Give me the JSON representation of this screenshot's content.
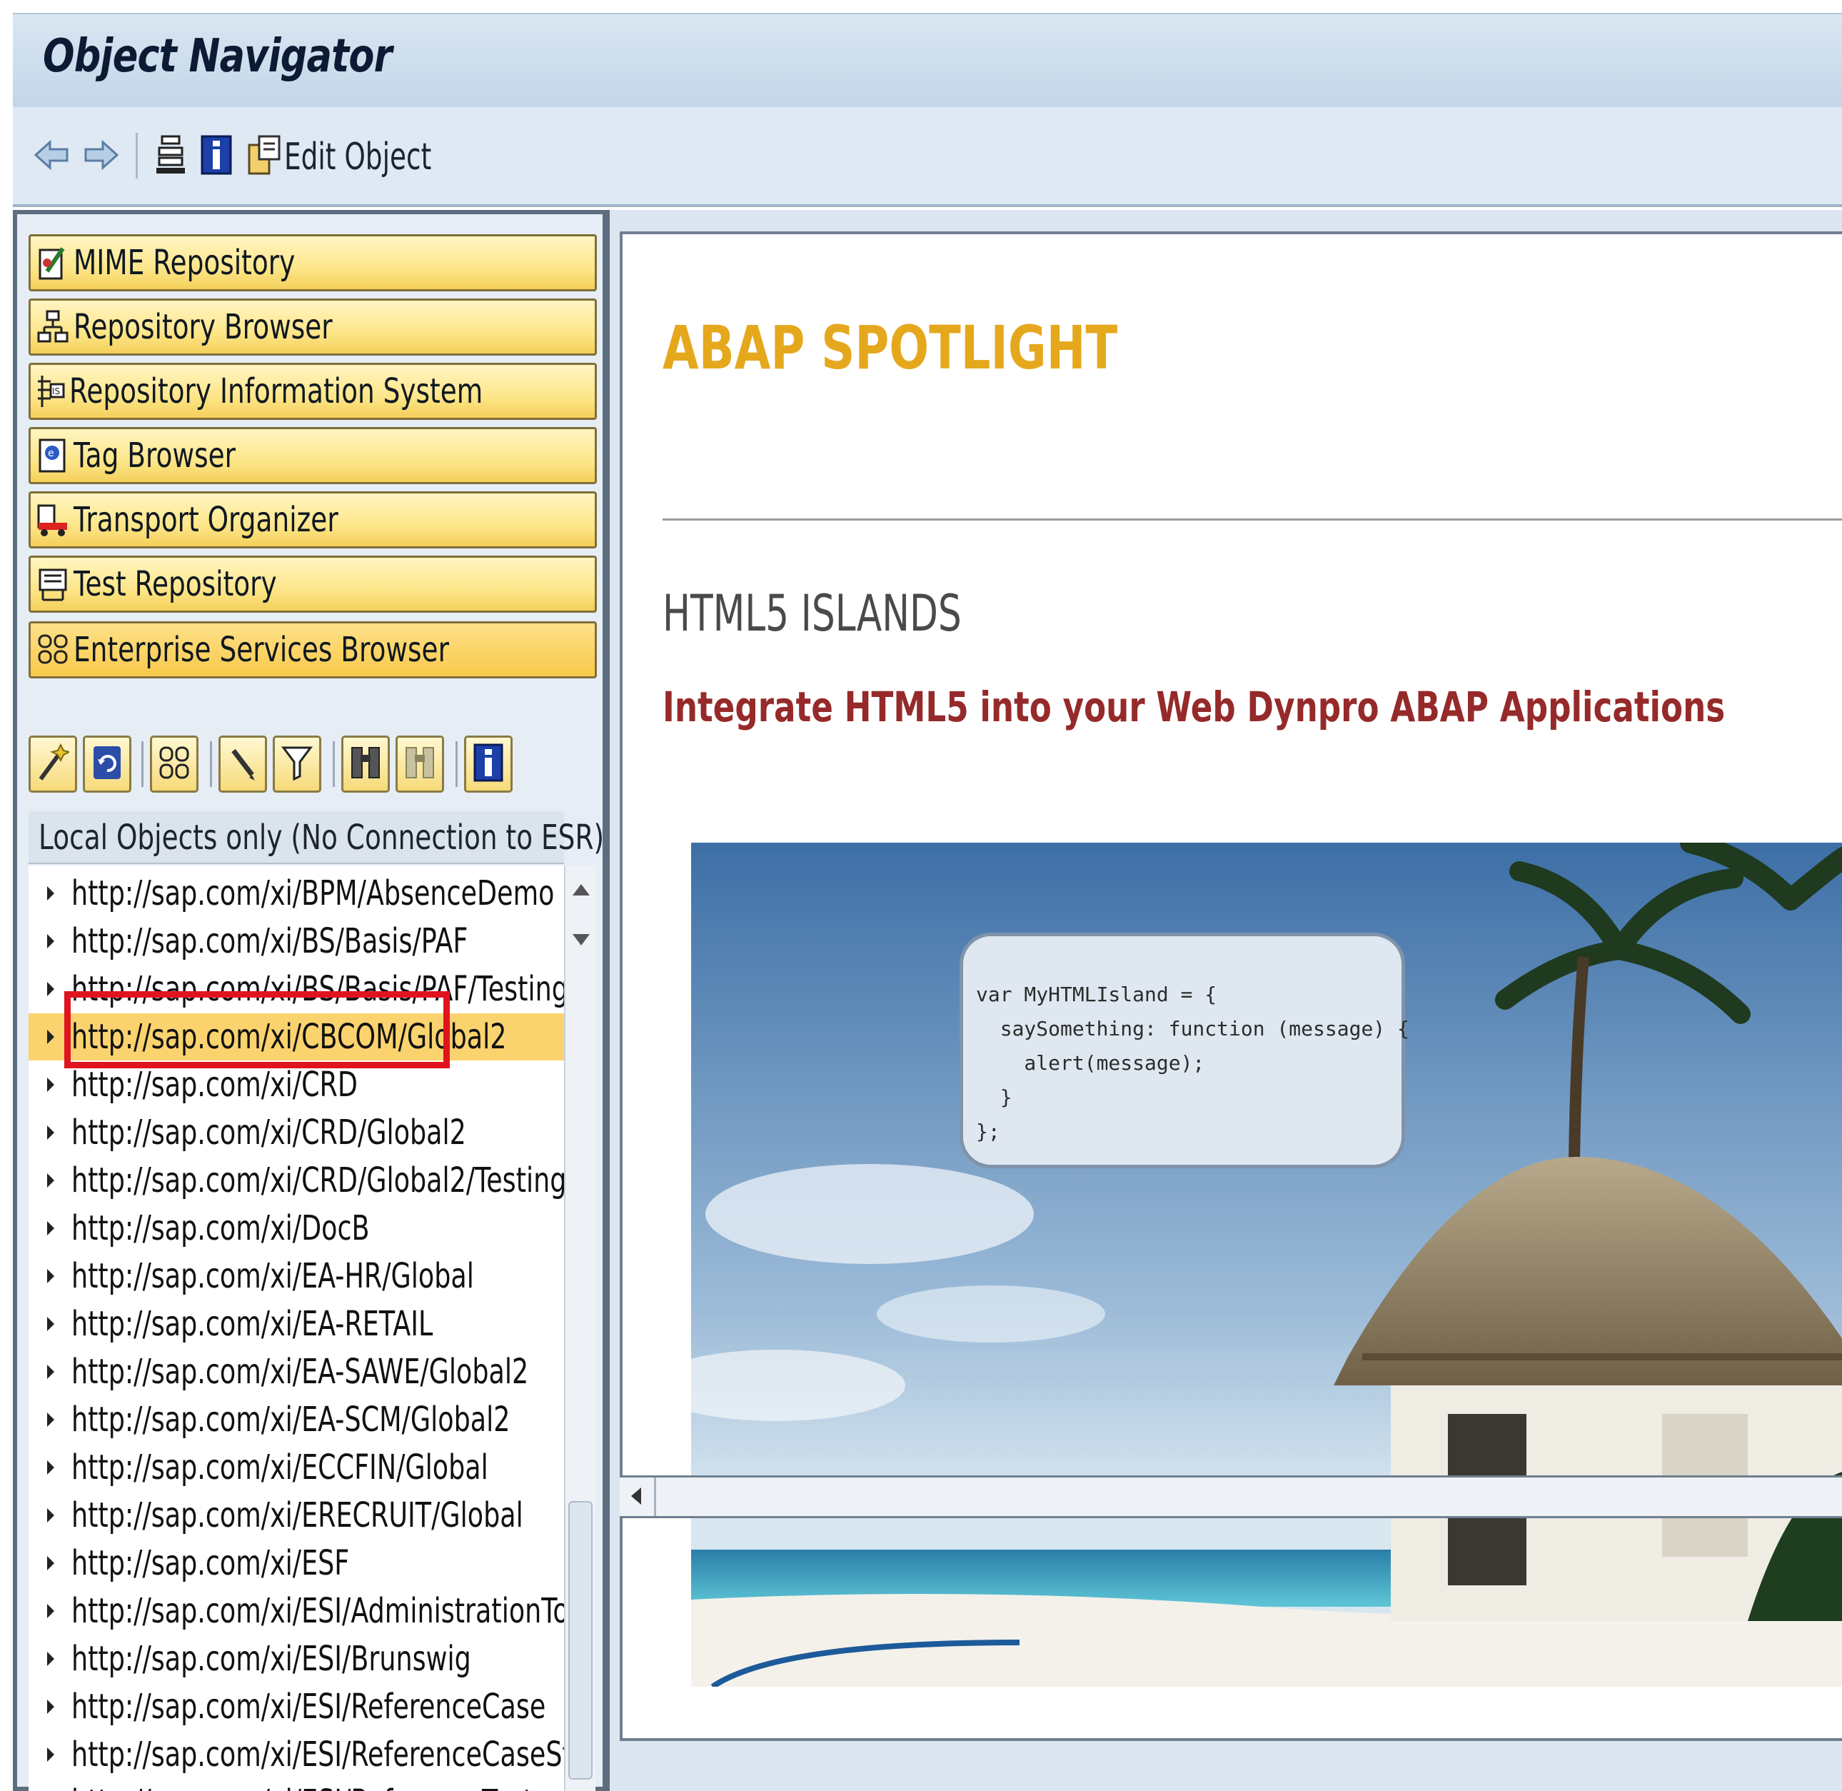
{
  "window": {
    "title": "Object Navigator"
  },
  "toolbar": {
    "edit_object_label": "Edit Object"
  },
  "nav_buttons": [
    {
      "label": "MIME Repository",
      "icon": "mime-icon"
    },
    {
      "label": "Repository Browser",
      "icon": "hierarchy-icon"
    },
    {
      "label": "Repository Information System",
      "icon": "info-system-icon"
    },
    {
      "label": "Tag Browser",
      "icon": "tag-icon"
    },
    {
      "label": "Transport Organizer",
      "icon": "truck-icon"
    },
    {
      "label": "Test Repository",
      "icon": "test-icon"
    },
    {
      "label": "Enterprise Services Browser",
      "icon": "services-icon",
      "active": true
    }
  ],
  "esr_tree": {
    "header": "Local Objects only (No Connection to ESR)",
    "selected_index": 3,
    "items": [
      "http://sap.com/xi/BPM/AbsenceDemo",
      "http://sap.com/xi/BS/Basis/PAF",
      "http://sap.com/xi/BS/Basis/PAF/Testing",
      "http://sap.com/xi/CBCOM/Global2",
      "http://sap.com/xi/CRD",
      "http://sap.com/xi/CRD/Global2",
      "http://sap.com/xi/CRD/Global2/Testing",
      "http://sap.com/xi/DocB",
      "http://sap.com/xi/EA-HR/Global",
      "http://sap.com/xi/EA-RETAIL",
      "http://sap.com/xi/EA-SAWE/Global2",
      "http://sap.com/xi/EA-SCM/Global2",
      "http://sap.com/xi/ECCFIN/Global",
      "http://sap.com/xi/ERECRUIT/Global",
      "http://sap.com/xi/ESF",
      "http://sap.com/xi/ESI/AdministrationTools",
      "http://sap.com/xi/ESI/Brunswig",
      "http://sap.com/xi/ESI/ReferenceCase",
      "http://sap.com/xi/ESI/ReferenceCaseStr",
      "http://sap.com/xi/ESI/ReferenceTest"
    ]
  },
  "content": {
    "spotlight_title": "ABAP SPOTLIGHT",
    "section_title": "HTML5 ISLANDS",
    "subtitle": "Integrate HTML5 into your Web Dynpro ABAP Applications",
    "code_lines": [
      "var MyHTMLIsland = {",
      "  saySomething: function (message) {",
      "    alert(message);",
      "  }",
      "};"
    ]
  },
  "colors": {
    "highlight_red": "#e0141e",
    "nav_yellow": "#fde68a",
    "spotlight_gold": "#e5a81d",
    "subtitle_red": "#962a2a"
  }
}
